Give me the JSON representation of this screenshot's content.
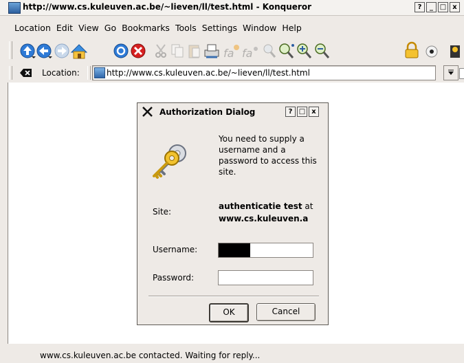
{
  "window": {
    "title": "http://www.cs.kuleuven.ac.be/~lieven/ll/test.html - Konqueror",
    "buttons": [
      "?",
      "_",
      "□",
      "x"
    ]
  },
  "menubar": {
    "items": [
      {
        "label": "Location"
      },
      {
        "label": "Edit"
      },
      {
        "label": "View"
      },
      {
        "label": "Go"
      },
      {
        "label": "Bookmarks"
      },
      {
        "label": "Tools"
      },
      {
        "label": "Settings"
      },
      {
        "label": "Window"
      },
      {
        "label": "Help"
      }
    ]
  },
  "toolbar": {
    "icons": [
      "up-icon",
      "back-icon",
      "forward-icon",
      "home-icon",
      "reload-icon",
      "stop-icon",
      "cut-icon",
      "copy-icon",
      "paste-icon",
      "print-icon",
      "increase-font-icon",
      "decrease-font-icon",
      "find-icon",
      "zoom-icon",
      "zoom-in-icon",
      "zoom-out-icon",
      "lock-icon",
      "security-icon",
      "settings-icon"
    ]
  },
  "location": {
    "label": "Location:",
    "url": "http://www.cs.kuleuven.ac.be/~lieven/ll/test.html"
  },
  "dialog": {
    "title": "Authorization Dialog",
    "buttons": [
      "?",
      "□",
      "x"
    ],
    "message": "You need to supply a username and a password to access this site.",
    "site_label": "Site:",
    "site_name": "authenticatie test",
    "site_at": "at",
    "site_host": "www.cs.kuleuven.a",
    "username_label": "Username:",
    "password_label": "Password:",
    "ok_label": "OK",
    "cancel_label": "Cancel"
  },
  "status": {
    "message": "www.cs.kuleuven.ac.be contacted. Waiting for reply..."
  }
}
